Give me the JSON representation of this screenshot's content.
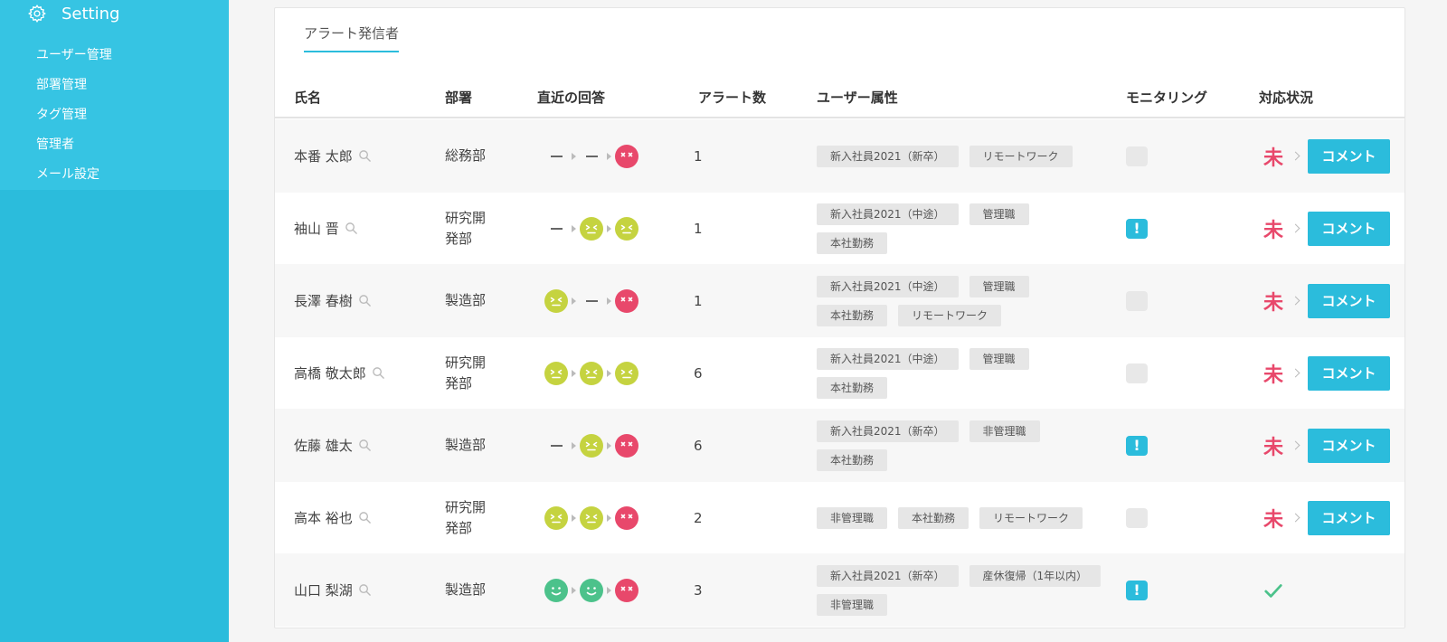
{
  "sidebar": {
    "header": "Setting",
    "items": [
      "ユーザー管理",
      "部署管理",
      "タグ管理",
      "管理者",
      "メール設定"
    ]
  },
  "card": {
    "tab": "アラート発信者",
    "columns": {
      "name": "氏名",
      "dept": "部署",
      "recent": "直近の回答",
      "alerts": "アラート数",
      "attrs": "ユーザー属性",
      "monitoring": "モニタリング",
      "status": "対応状況"
    },
    "comment_label": "コメント",
    "pending_mark": "未",
    "rows": [
      {
        "name": "本番 太郎",
        "dept": "総務部",
        "answers": [
          "none",
          "none",
          "bad"
        ],
        "alerts": "1",
        "tags": [
          "新入社員2021（新卒）",
          "リモートワーク"
        ],
        "monitoring": "off",
        "status": "pending"
      },
      {
        "name": "袖山 晋",
        "dept": "研究開発部",
        "answers": [
          "none",
          "meh",
          "meh"
        ],
        "alerts": "1",
        "tags": [
          "新入社員2021（中途）",
          "管理職",
          "本社勤務"
        ],
        "monitoring": "alert",
        "status": "pending"
      },
      {
        "name": "長澤 春樹",
        "dept": "製造部",
        "answers": [
          "meh",
          "none",
          "bad"
        ],
        "alerts": "1",
        "tags": [
          "新入社員2021（中途）",
          "管理職",
          "本社勤務",
          "リモートワーク"
        ],
        "monitoring": "off",
        "status": "pending"
      },
      {
        "name": "高橋 敬太郎",
        "dept": "研究開発部",
        "answers": [
          "meh",
          "meh",
          "meh"
        ],
        "alerts": "6",
        "tags": [
          "新入社員2021（中途）",
          "管理職",
          "本社勤務"
        ],
        "monitoring": "off",
        "status": "pending"
      },
      {
        "name": "佐藤 雄太",
        "dept": "製造部",
        "answers": [
          "none",
          "meh",
          "bad"
        ],
        "alerts": "6",
        "tags": [
          "新入社員2021（新卒）",
          "非管理職",
          "本社勤務"
        ],
        "monitoring": "alert",
        "status": "pending"
      },
      {
        "name": "高本 裕也",
        "dept": "研究開発部",
        "answers": [
          "meh",
          "meh",
          "bad"
        ],
        "alerts": "2",
        "tags": [
          "非管理職",
          "本社勤務",
          "リモートワーク"
        ],
        "monitoring": "off",
        "status": "pending"
      },
      {
        "name": "山口 梨湖",
        "dept": "製造部",
        "answers": [
          "good",
          "good",
          "bad"
        ],
        "alerts": "3",
        "tags": [
          "新入社員2021（新卒）",
          "産休復帰（1年以内）",
          "非管理職"
        ],
        "monitoring": "alert",
        "status": "done"
      }
    ]
  },
  "colors": {
    "accent": "#2bbcdc",
    "bad": "#e8486b",
    "meh": "#c5d340",
    "good": "#4cc28b",
    "done": "#4cc28b"
  },
  "icons": {
    "sidebar": "gear-icon",
    "name": "search-icon",
    "monitoring_alert": "exclamation-icon",
    "done": "check-icon"
  }
}
